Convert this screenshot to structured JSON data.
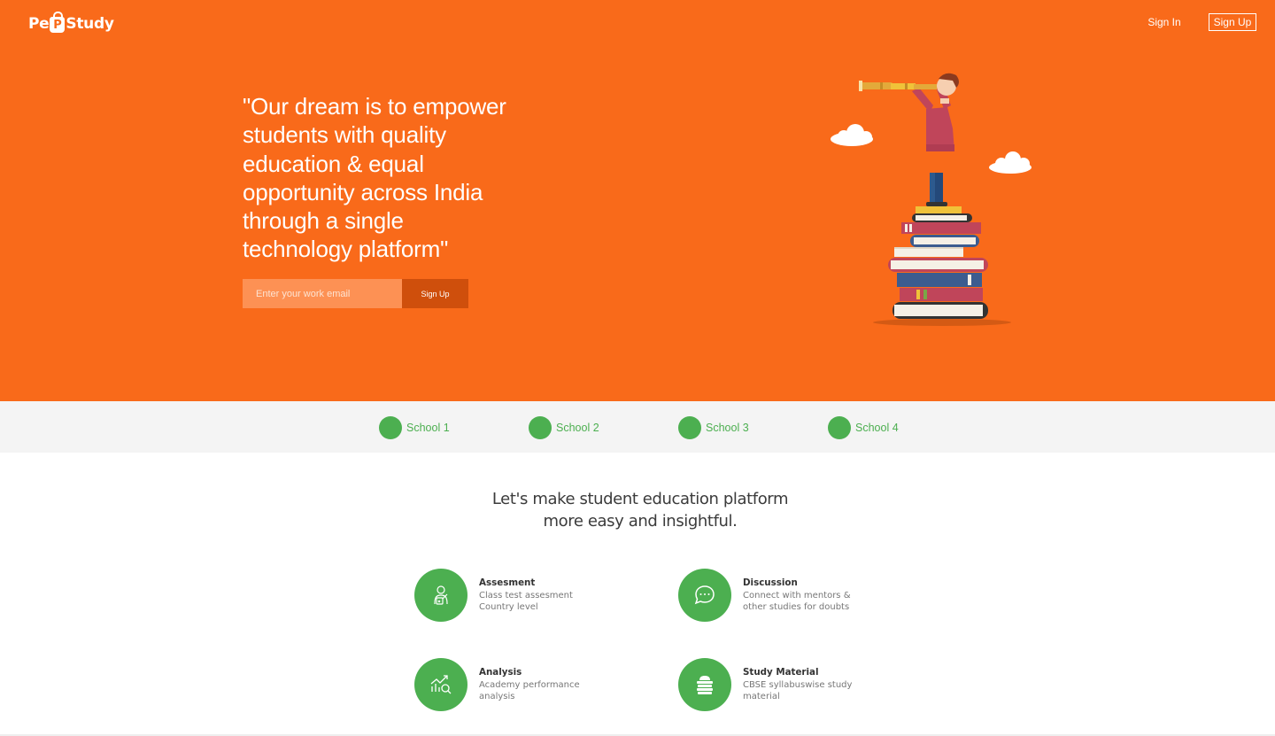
{
  "brand": {
    "logo_left": "Pe",
    "logo_mark": "P",
    "logo_right": "Study"
  },
  "nav": {
    "sign_in": "Sign In",
    "sign_up": "Sign Up"
  },
  "hero": {
    "quote": "\"Our dream is to empower students with quality education & equal opportunity across India through a single technology platform\"",
    "email_placeholder": "Enter your work email",
    "signup_button": "Sign Up"
  },
  "schools": [
    "School 1",
    "School 2",
    "School 3",
    "School 4"
  ],
  "tagline": {
    "line1": "Let's make student education platform",
    "line2": "more easy and insightful."
  },
  "features": [
    {
      "title": "Assesment",
      "desc_line1": "Class test assesment",
      "desc_line2": "Country level",
      "icon": "assessment-icon"
    },
    {
      "title": "Discussion",
      "desc_line1": "Connect with mentors &",
      "desc_line2": "other studies for doubts",
      "icon": "chat-bubble-icon"
    },
    {
      "title": "Analysis",
      "desc_line1": "Academy performance",
      "desc_line2": "analysis",
      "icon": "chart-analysis-icon"
    },
    {
      "title": "Study Material",
      "desc_line1": "CBSE syllabuswise study",
      "desc_line2": "material",
      "icon": "books-stack-icon"
    }
  ],
  "colors": {
    "brand_orange": "#f96a1a",
    "accent_green": "#4caf50",
    "dark_orange": "#cf4f0c"
  }
}
